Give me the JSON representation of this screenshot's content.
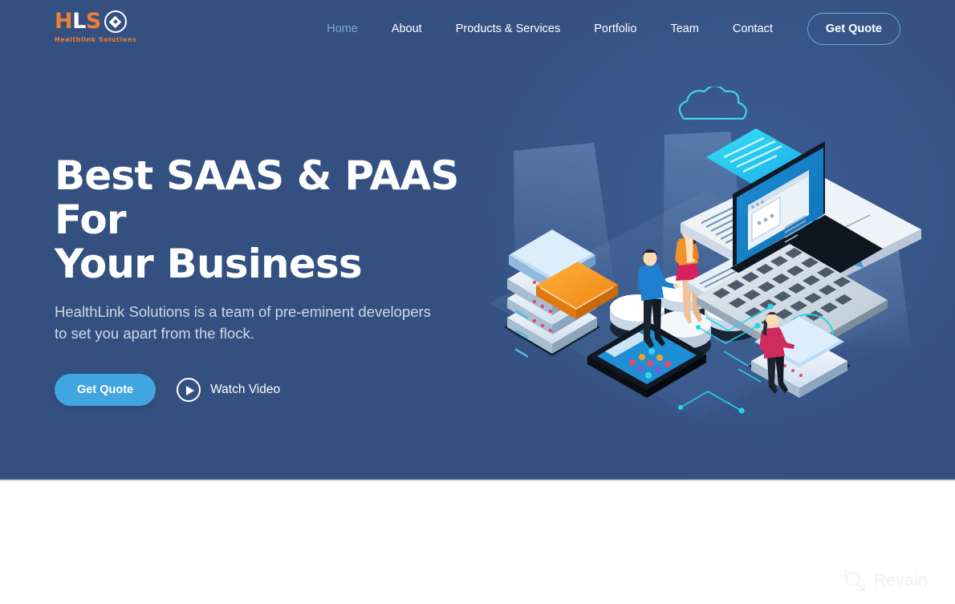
{
  "brand": {
    "mark_letters": [
      "HLS"
    ],
    "letter_h": "HL",
    "letter_s": "S",
    "tagline": "Healthlink Solutions",
    "accent_orange": "#ef7e34"
  },
  "header": {
    "nav_items": [
      {
        "label": "Home",
        "active": true
      },
      {
        "label": "About",
        "active": false
      },
      {
        "label": "Products & Services",
        "active": false
      },
      {
        "label": "Portfolio",
        "active": false
      },
      {
        "label": "Team",
        "active": false
      },
      {
        "label": "Contact",
        "active": false
      }
    ],
    "cta_label": "Get Quote",
    "active_color": "#7aa8d8",
    "cta_border_color": "#64a9dd"
  },
  "hero": {
    "title_line1": "Best SAAS & PAAS For",
    "title_line2": "Your Business",
    "subtitle": "HealthLink Solutions is a team of pre-eminent developers to set you apart from the flock.",
    "primary_button": "Get Quote",
    "secondary_button": "Watch Video",
    "background_color": "#345080",
    "primary_button_color": "#41a5e0",
    "illustration_name": "isometric-saas-cloud-infrastructure-illustration"
  },
  "watermark": {
    "label": "Revain"
  }
}
